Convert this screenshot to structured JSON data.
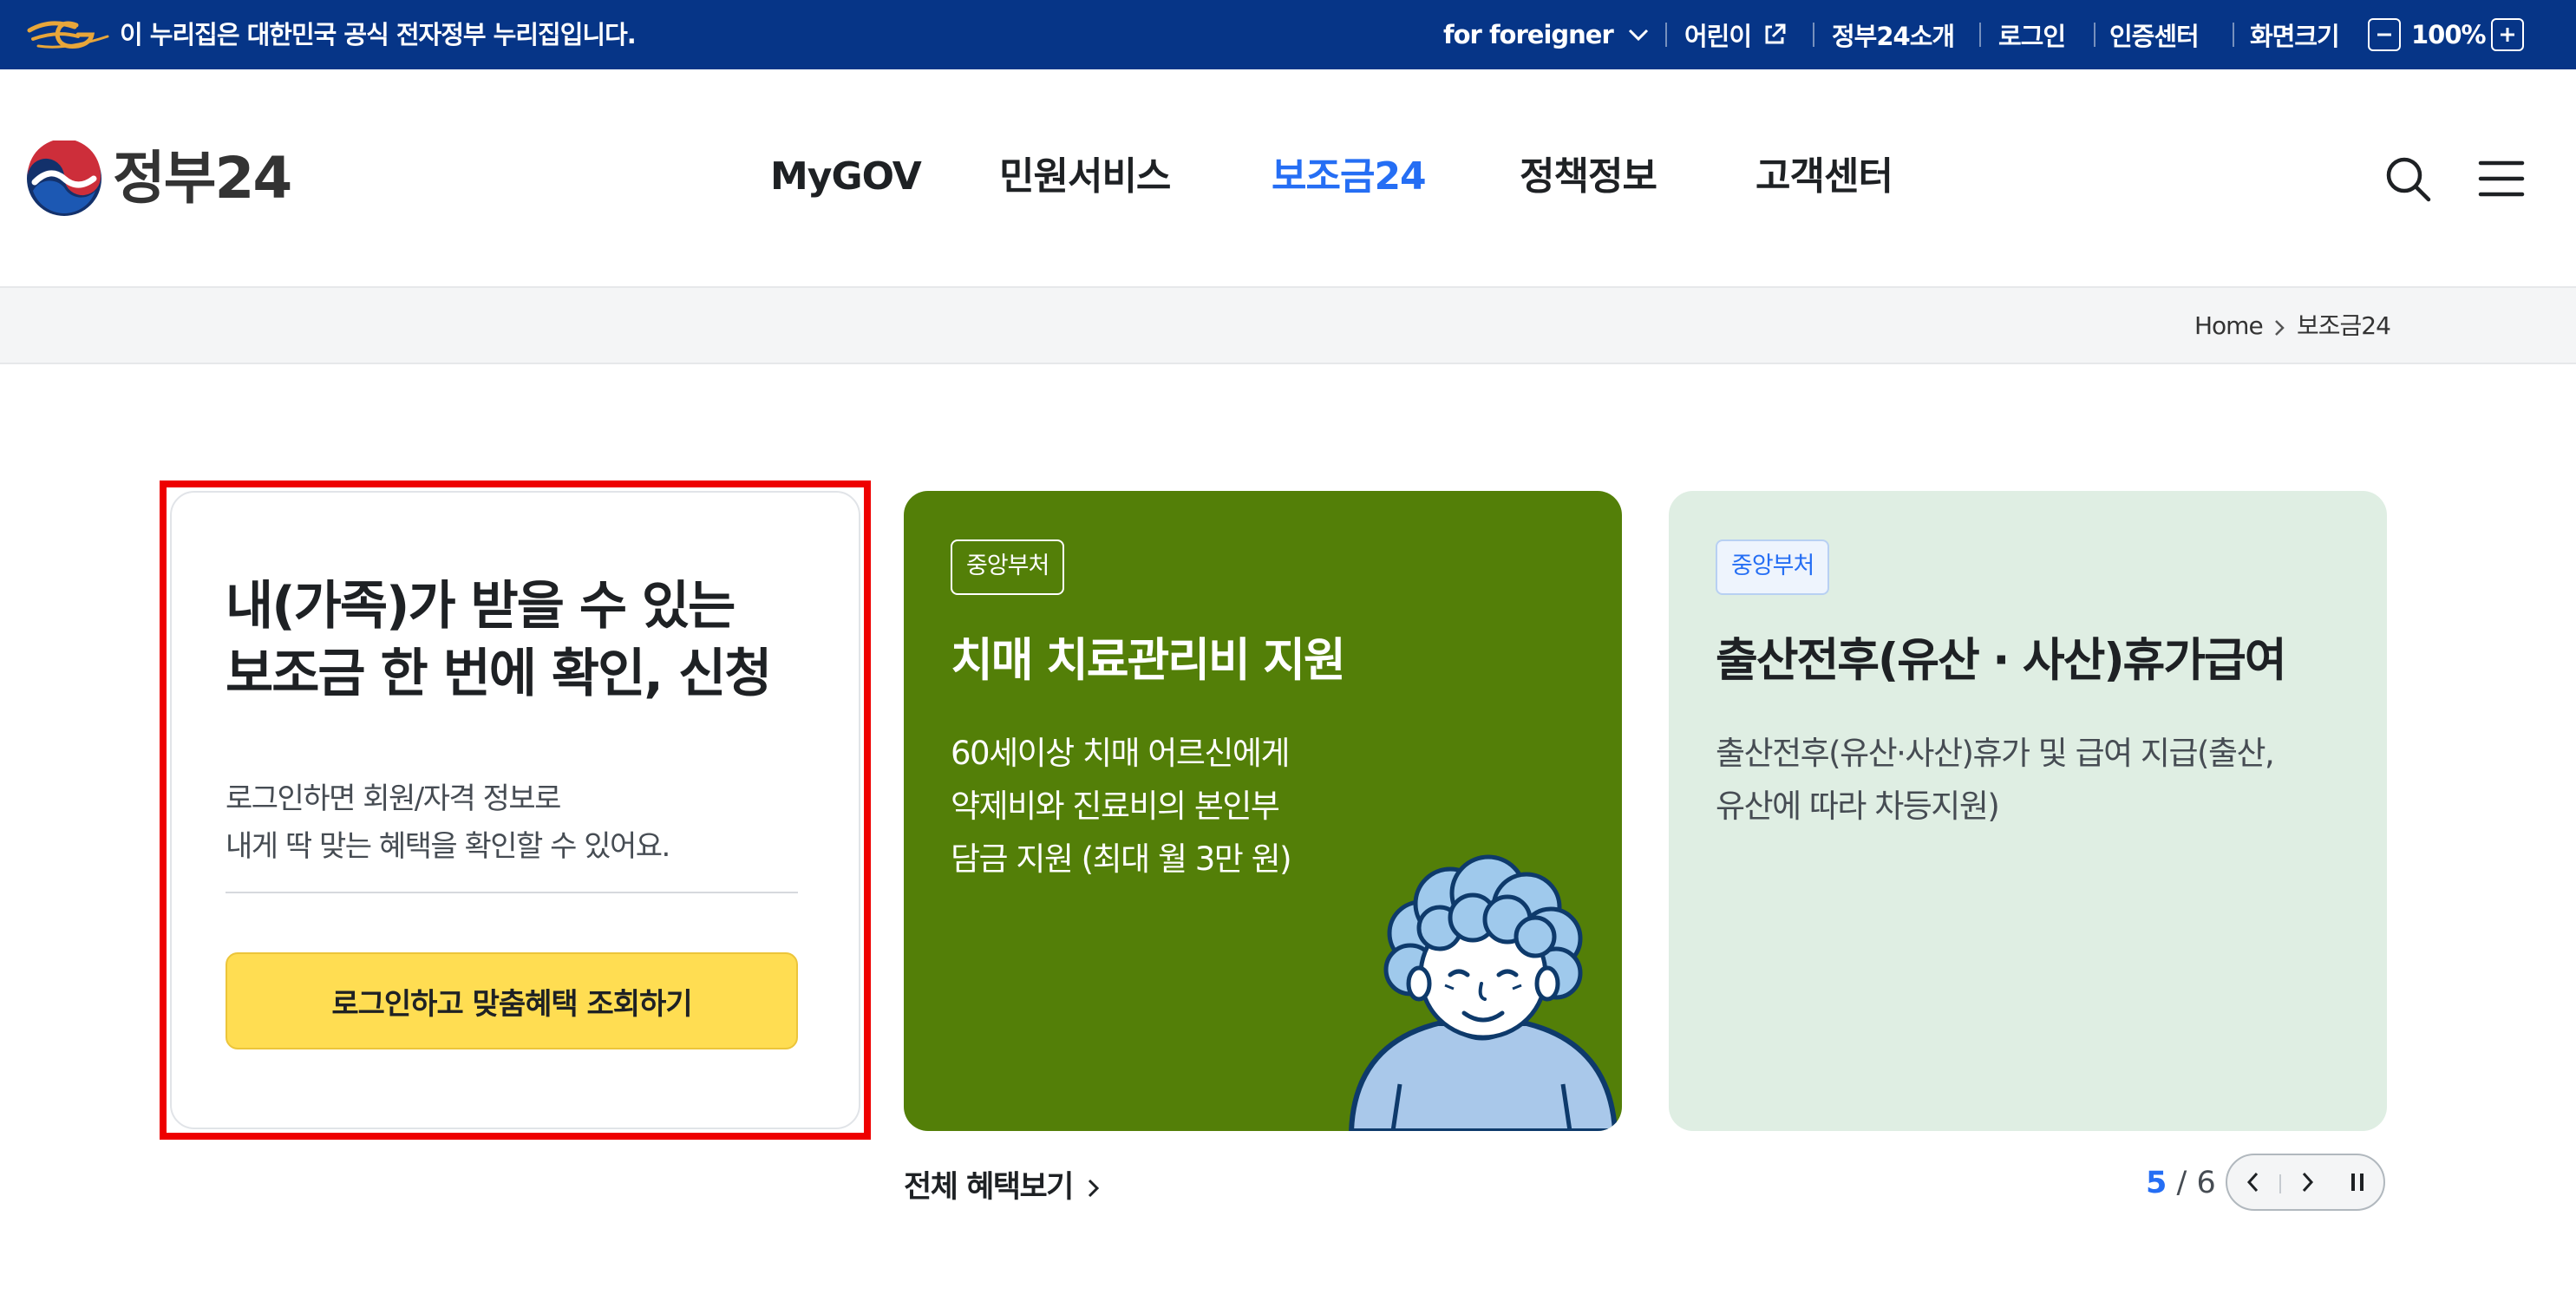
{
  "gov_bar": {
    "official_notice": "이 누리집은 대한민국 공식 전자정부 누리집입니다.",
    "foreigner_label": "for foreigner",
    "kids_label": "어린이",
    "about_label": "정부24소개",
    "login_label": "로그인",
    "cert_center_label": "인증센터",
    "screen_size_label": "화면크기",
    "zoom_value": "100%"
  },
  "header": {
    "logo_text": "정부24",
    "nav": [
      {
        "label": "MyGOV"
      },
      {
        "label": "민원서비스"
      },
      {
        "label": "보조금24",
        "active": true
      },
      {
        "label": "정책정보"
      },
      {
        "label": "고객센터"
      }
    ],
    "active_color": "#256ef4"
  },
  "breadcrumb": {
    "home": "Home",
    "current": "보조금24"
  },
  "login_card": {
    "title_line1": "내(가족)가 받을 수 있는",
    "title_line2": "보조금 한 번에 확인, 신청",
    "desc_line1": "로그인하면 회원/자격 정보로",
    "desc_line2": "내게 딱 맞는 혜택을 확인할 수 있어요.",
    "button_label": "로그인하고 맞춤혜택 조회하기",
    "button_color": "#ffdd52",
    "highlight_color": "#ee0000"
  },
  "cards": [
    {
      "badge": "중앙부처",
      "title": "치매 치료관리비 지원",
      "desc_lines": [
        "60세이상 치매 어르신에게",
        "약제비와 진료비의 본인부",
        "담금 지원 (최대 월 3만 원)"
      ],
      "bg_color": "#537f08",
      "illustration": "grandmother-illustration"
    },
    {
      "badge": "중앙부처",
      "title": "출산전후(유산 · 사산)휴가급여",
      "desc_lines": [
        "출산전후(유산·사산)휴가 및 급여 지급(출산,",
        "유산에 따라 차등지원)"
      ],
      "bg_color": "#dfeee3"
    }
  ],
  "footer": {
    "more_label": "전체 혜택보기",
    "pager_current": "5",
    "pager_separator": "/",
    "pager_total": "6"
  },
  "icons": {
    "gov": "gov-eg-icon",
    "chevron": "chevron-down-icon",
    "external": "external-link-icon",
    "minus": "zoom-out-icon",
    "plus": "zoom-in-icon",
    "search": "search-icon",
    "menu": "hamburger-menu-icon",
    "prev": "prev-arrow-icon",
    "next": "next-arrow-icon",
    "pause": "pause-icon"
  }
}
